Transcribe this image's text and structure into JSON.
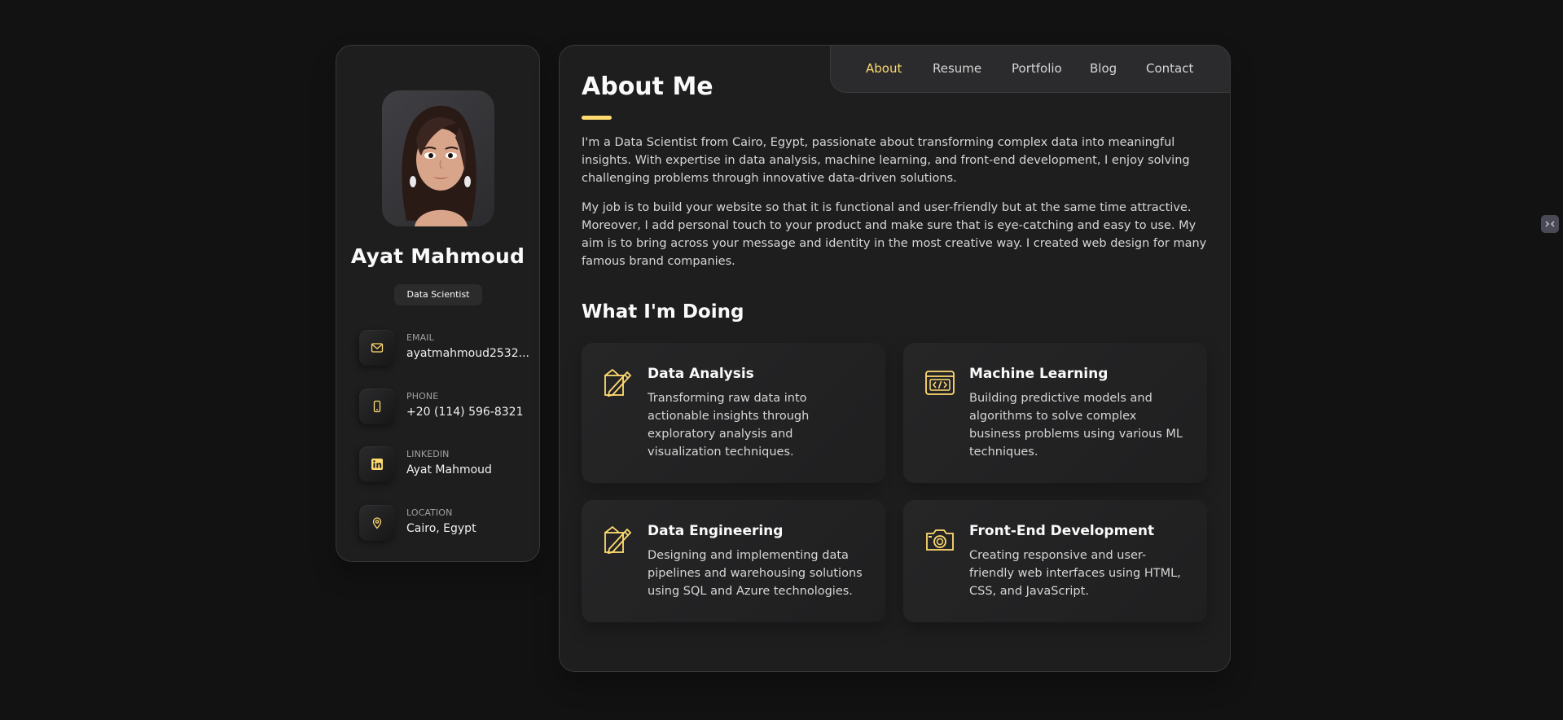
{
  "profile": {
    "name": "Ayat Mahmoud",
    "title": "Data Scientist",
    "avatar_icon": "memoji-avatar"
  },
  "contacts": [
    {
      "icon": "mail-icon",
      "label": "Email",
      "value": "ayatmahmoud2532..."
    },
    {
      "icon": "phone-icon",
      "label": "Phone",
      "value": "+20 (114) 596-8321"
    },
    {
      "icon": "linkedin-icon",
      "label": "Linkedin",
      "value": "Ayat Mahmoud"
    },
    {
      "icon": "location-icon",
      "label": "Location",
      "value": "Cairo, Egypt"
    }
  ],
  "nav": {
    "items": [
      "About",
      "Resume",
      "Portfolio",
      "Blog",
      "Contact"
    ],
    "active": "About"
  },
  "about": {
    "title": "About Me",
    "paragraphs": [
      "I'm a Data Scientist from Cairo, Egypt, passionate about transforming complex data into meaningful insights. With expertise in data analysis, machine learning, and front-end development, I enjoy solving challenging problems through innovative data-driven solutions.",
      "My job is to build your website so that it is functional and user-friendly but at the same time attractive. Moreover, I add personal touch to your product and make sure that is eye-catching and easy to use. My aim is to bring across your message and identity in the most creative way. I created web design for many famous brand companies."
    ]
  },
  "services": {
    "title": "What I'm Doing",
    "items": [
      {
        "icon": "design-pencil-icon",
        "title": "Data Analysis",
        "text": "Transforming raw data into actionable insights through exploratory analysis and visualization techniques."
      },
      {
        "icon": "code-window-icon",
        "title": "Machine Learning",
        "text": "Building predictive models and algorithms to solve complex business problems using various ML techniques."
      },
      {
        "icon": "design-pencil-icon",
        "title": "Data Engineering",
        "text": "Designing and implementing data pipelines and warehousing solutions using SQL and Azure technologies."
      },
      {
        "icon": "camera-icon",
        "title": "Front-End Development",
        "text": "Creating responsive and user-friendly web interfaces using HTML, CSS, and JavaScript."
      }
    ]
  },
  "colors": {
    "accent": "#ffdb70",
    "background": "#121212",
    "panel": "#1e1e1f"
  }
}
